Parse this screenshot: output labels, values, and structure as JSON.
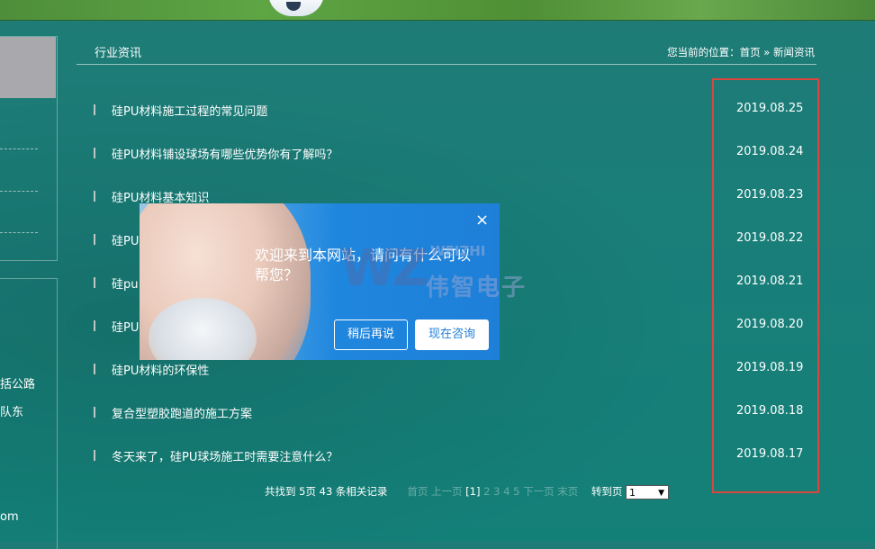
{
  "header": {
    "category_title": "行业资讯",
    "breadcrumb_prefix": "您当前的位置：",
    "breadcrumb_home": "首页",
    "breadcrumb_sep": "»",
    "breadcrumb_current": "新闻资讯"
  },
  "sidebar": {
    "fragment_1": "括公路",
    "fragment_2": "队东",
    "fragment_3": "om"
  },
  "news": [
    {
      "title": "硅PU材料施工过程的常见问题",
      "date": "2019.08.25"
    },
    {
      "title": "硅PU材料铺设球场有哪些优势你有了解吗？",
      "date": "2019.08.24"
    },
    {
      "title": "硅PU材料基本知识",
      "date": "2019.08.23"
    },
    {
      "title": "硅PU",
      "date": "2019.08.22"
    },
    {
      "title": "硅pu",
      "date": "2019.08.21"
    },
    {
      "title": "硅PU",
      "date": "2019.08.20"
    },
    {
      "title": "硅PU材料的环保性",
      "date": "2019.08.19"
    },
    {
      "title": "复合型塑胶跑道的施工方案",
      "date": "2019.08.18"
    },
    {
      "title": "冬天来了，硅PU球场施工时需要注意什么？",
      "date": "2019.08.17"
    }
  ],
  "pagination": {
    "summary": "共找到 5页 43 条相关记录",
    "first": "首页",
    "prev": "上一页",
    "current": "[1]",
    "pages": [
      "2",
      "3",
      "4",
      "5"
    ],
    "next": "下一页",
    "last": "末页",
    "goto_label": "转到页",
    "selected_page": "1"
  },
  "popup": {
    "message": "欢迎来到本网站，请问有什么可以帮您？",
    "close_symbol": "×",
    "later_label": "稍后再说",
    "consult_label": "现在咨询"
  },
  "watermark": {
    "logo": "WZ",
    "top": "WEIZHI",
    "name": "伟智电子"
  },
  "colors": {
    "background": "#1a7e79",
    "highlight_box": "#d9473f",
    "popup_blue": "#1f86de"
  }
}
